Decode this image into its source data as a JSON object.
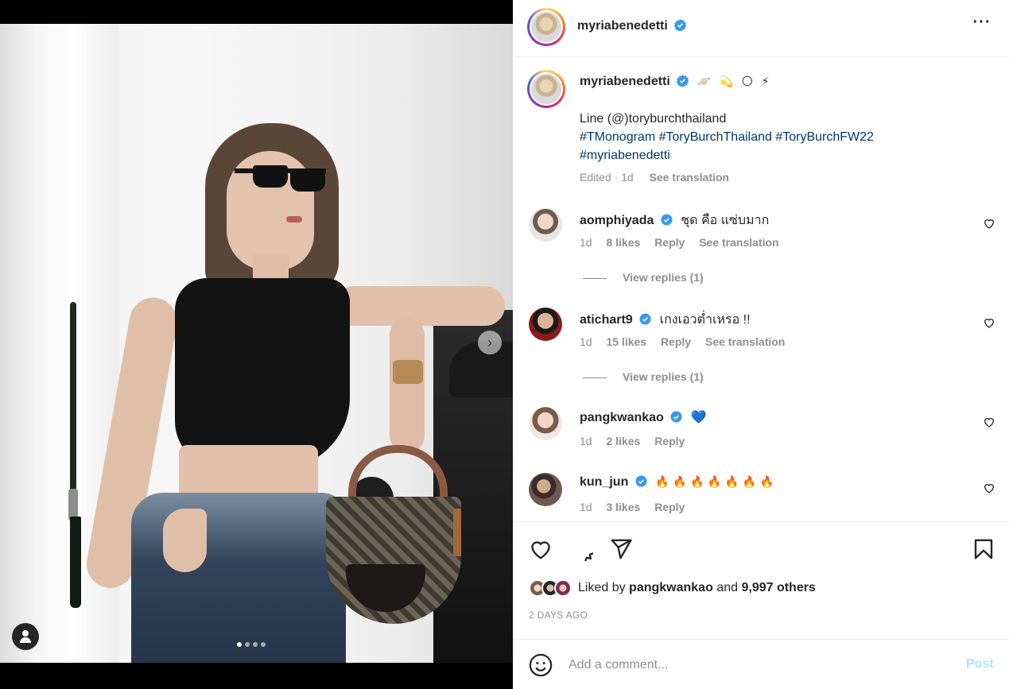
{
  "post": {
    "author": "myriabenedetti",
    "photo_count": 4,
    "active_photo": 1
  },
  "caption": {
    "author": "myriabenedetti",
    "emojis": [
      "🪐",
      "💫",
      "🌕",
      "⚡"
    ],
    "line1": "Line (@)toryburchthailand",
    "hashtags": "#TMonogram #ToryBurchThailand #ToryBurchFW22",
    "hashtag2": "#myriabenedetti",
    "edited": "Edited · 1d",
    "translate": "See translation"
  },
  "comments": [
    {
      "user": "aomphiyada",
      "text": "ชุด คือ แซ่บมาก",
      "time": "1d",
      "likes": "8 likes",
      "reply": "Reply",
      "translate": "See translation",
      "view_replies": "View replies (1)"
    },
    {
      "user": "atichart9",
      "text": "เกงเอวต่ำเหรอ !!",
      "time": "1d",
      "likes": "15 likes",
      "reply": "Reply",
      "translate": "See translation",
      "view_replies": "View replies (1)"
    },
    {
      "user": "pangkwankao",
      "text": "💙",
      "time": "1d",
      "likes": "2 likes",
      "reply": "Reply"
    },
    {
      "user": "kun_jun",
      "text": "🔥 🔥 🔥 🔥 🔥 🔥 🔥",
      "time": "1d",
      "likes": "3 likes",
      "reply": "Reply"
    }
  ],
  "likes": {
    "prefix": "Liked by",
    "user": "pangkwankao",
    "joiner": "and",
    "others": "9,997 others"
  },
  "date": "2 DAYS AGO",
  "add_comment": {
    "placeholder": "Add a comment...",
    "post_label": "Post"
  },
  "icons": {
    "verified": "verified-badge-icon",
    "more": "more-options-icon",
    "like": "heart-icon",
    "comment": "comment-icon",
    "share": "paper-plane-icon",
    "save": "bookmark-icon",
    "emoji": "smiley-icon",
    "tag": "user-tag-icon",
    "next": "chevron-right-icon"
  },
  "colors": {
    "verified": "#3897f0",
    "hashtag": "#00376b",
    "secondary_text": "#8e8e8e",
    "post_disabled": "#b2dffc"
  }
}
